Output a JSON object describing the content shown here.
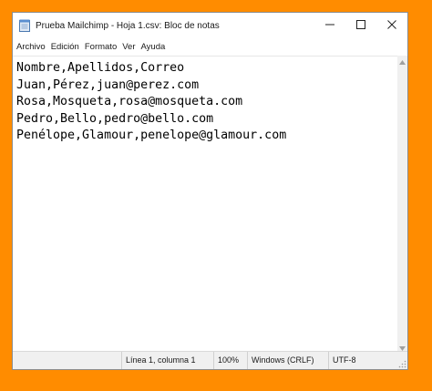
{
  "window": {
    "title": "Prueba Mailchimp - Hoja 1.csv: Bloc de notas",
    "app_icon": "notepad-icon",
    "controls": {
      "minimize_icon": "minimize-icon",
      "maximize_icon": "maximize-icon",
      "close_icon": "close-icon"
    }
  },
  "menu": {
    "items": [
      "Archivo",
      "Edición",
      "Formato",
      "Ver",
      "Ayuda"
    ]
  },
  "editor": {
    "lines": [
      "Nombre,Apellidos,Correo",
      "Juan,Pérez,juan@perez.com",
      "Rosa,Mosqueta,rosa@mosqueta.com",
      "Pedro,Bello,pedro@bello.com",
      "Penélope,Glamour,penelope@glamour.com"
    ]
  },
  "statusbar": {
    "position": "Línea 1, columna 1",
    "zoom": "100%",
    "line_endings": "Windows (CRLF)",
    "encoding": "UTF-8"
  },
  "colors": {
    "background": "#ff8c00",
    "window": "#ffffff",
    "statusbar": "#f0f0f0"
  }
}
